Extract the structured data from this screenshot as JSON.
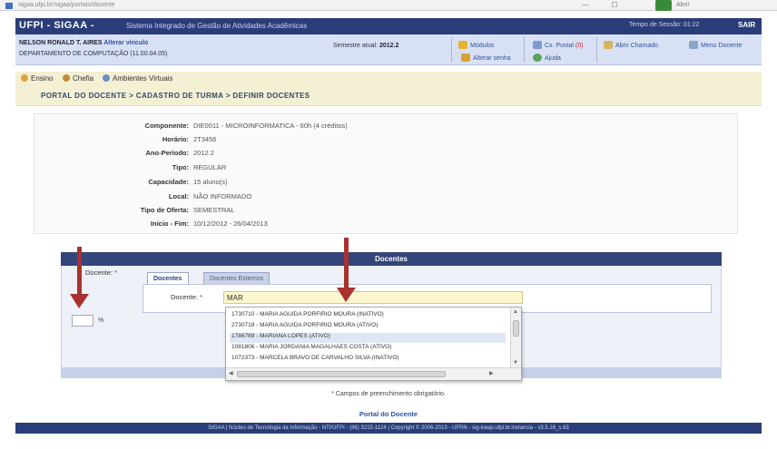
{
  "browser": {
    "url": "sigaa.ufpi.br/sigaa/portais/docente",
    "window_buttons": [
      "—",
      "☐"
    ],
    "extension_label": "Abrir"
  },
  "topbar": {
    "brand": "UFPI - SIGAA -",
    "system_title": "Sistema Integrado de Gestão de Atividades Acadêmicas",
    "session_timer": "Tempo de Sessão: 01:22",
    "logout_label": "SAIR"
  },
  "user": {
    "name": "NELSON RONALD T. AIRES",
    "change_link": "Alterar vínculo",
    "department": "DEPARTAMENTO DE COMPUTAÇÃO (11.00.04.05)",
    "semester_label": "Semestre atual:",
    "semester_value": "2012.2"
  },
  "quick_links": {
    "modules": "Módulos",
    "change_notes": "Alterar senha",
    "mailbox": "Cx. Postal",
    "mailbox_badge": "(0)",
    "help": "Ajuda",
    "open_ticket": "Abrir Chamado",
    "site_map": "Menu Docente"
  },
  "menu": {
    "ensino": "Ensino",
    "chefia": "Chefia",
    "ambientes": "Ambientes Virtuais"
  },
  "breadcrumb": "PORTAL DO DOCENTE > CADASTRO DE TURMA > DEFINIR DOCENTES",
  "details": [
    {
      "label": "Componente:",
      "value": "DIE0011 - MICROINFORMATICA - 60h (4 créditos)"
    },
    {
      "label": "Horário:",
      "value": "2T3456"
    },
    {
      "label": "Ano-Período:",
      "value": "2012.2"
    },
    {
      "label": "Tipo:",
      "value": "REGULAR"
    },
    {
      "label": "Capacidade:",
      "value": "15 aluno(s)"
    },
    {
      "label": "Local:",
      "value": "NÃO INFORMADO"
    },
    {
      "label": "Tipo de Oferta:",
      "value": "SEMESTRAL"
    },
    {
      "label": "Início - Fim:",
      "value": "10/12/2012 - 26/04/2013"
    }
  ],
  "docentes": {
    "header": "Docentes",
    "outer_label": "Docente:",
    "required_mark": "*",
    "tabs": [
      "Docentes",
      "Docentes Externos"
    ],
    "inner_label": "Docente:",
    "search_value": "MAR",
    "percent_sign": "%",
    "suggestions": [
      "1730710 - MARIA AGUIDA PORFIRIO MOURA (INATIVO)",
      "2730718 - MARIA AGUIDA PORFIRIO MOURA (ATIVO)",
      "1786789 - MARIANA LOPES (ATIVO)",
      "1081806 - MARIA JORDANIA MAGALHAES COSTA (ATIVO)",
      "1072373 - MARCELA BRAVO DE CARVALHO SILVA (INATIVO)"
    ]
  },
  "required_note": "* Campos de preenchimento obrigatório.",
  "portal_link": "Portal do Docente",
  "footer": "SIGAA | Núcleo de Tecnologia da Informação - NTI/UFPI - (86) 3215-1124 | Copyright © 2006-2013 - UFRN - sig-kwap.ufpi.br.instancia - v3.5.16_s.63"
}
